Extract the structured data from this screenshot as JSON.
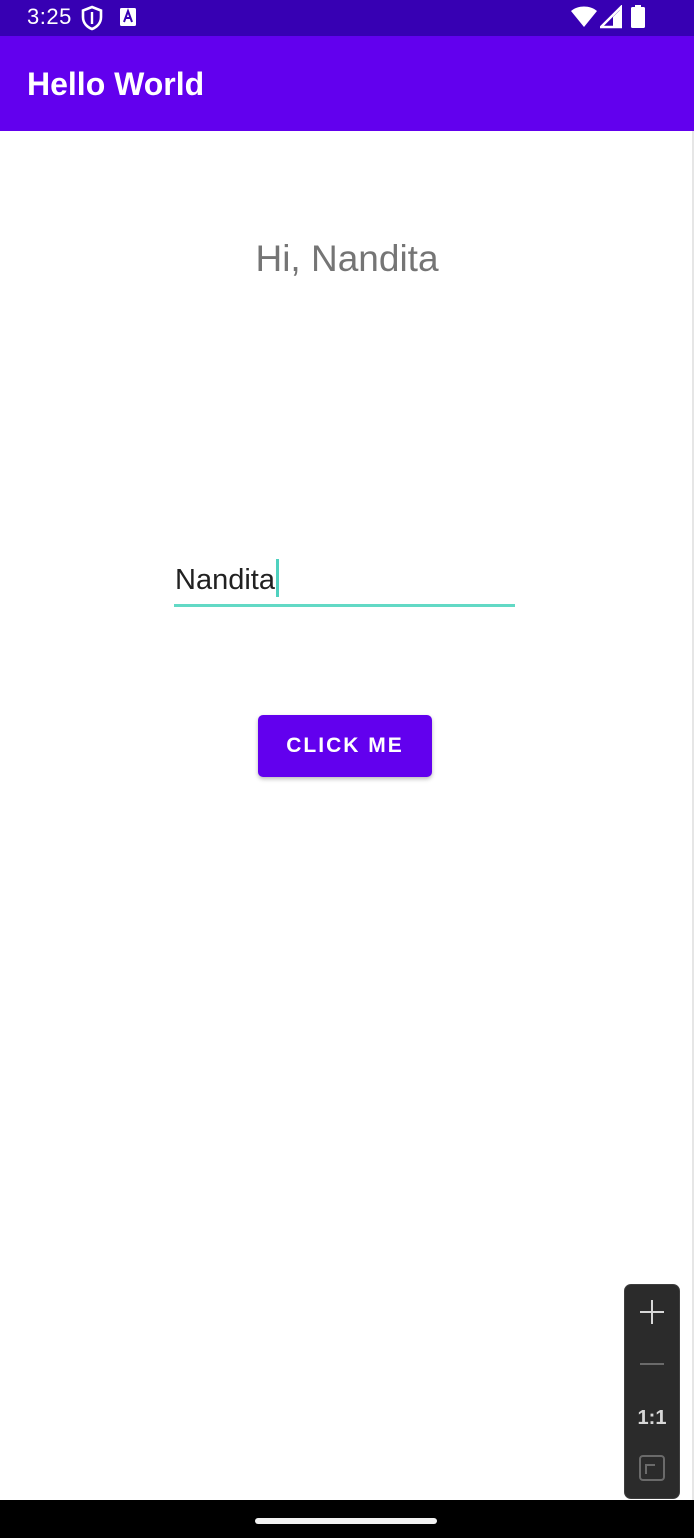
{
  "status_bar": {
    "time": "3:25",
    "left_icons": [
      "shield-icon",
      "keyboard-a-icon"
    ],
    "right_icons": [
      "wifi-icon",
      "cell-signal-icon",
      "battery-icon"
    ],
    "background_color": "#3700b3"
  },
  "app_bar": {
    "title": "Hello World",
    "background_color": "#6200ee"
  },
  "main": {
    "greeting": "Hi, Nandita",
    "name_input": {
      "value": "Nandita",
      "underline_color": "#62d9c5"
    },
    "button": {
      "label": "CLICK ME",
      "background_color": "#6200ee"
    }
  },
  "zoom_controls": {
    "zoom_in_icon": "plus-icon",
    "zoom_out_icon": "minus-icon",
    "actual_size_label": "1:1",
    "fit_screen_icon": "fit-screen-icon"
  },
  "nav_bar": {
    "handle": "home-gesture-handle"
  }
}
